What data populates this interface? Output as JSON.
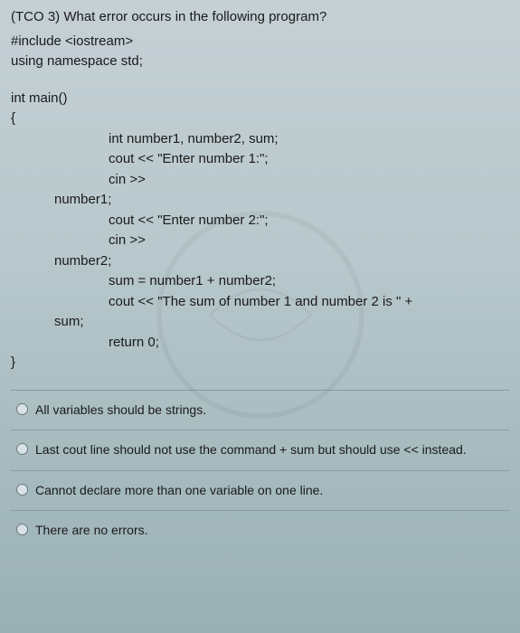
{
  "question": {
    "header": "(TCO 3) What error occurs in the following program?",
    "code_lines": [
      {
        "class": "indent1",
        "text": "#include <iostream>"
      },
      {
        "class": "indent1",
        "text": "using namespace std;"
      },
      {
        "class": "blank",
        "text": ""
      },
      {
        "class": "indent1",
        "text": "int main()"
      },
      {
        "class": "indent1",
        "text": "{"
      },
      {
        "class": "indent3",
        "text": "int number1, number2, sum;"
      },
      {
        "class": "indent3",
        "text": "cout << \"Enter number 1:\";"
      },
      {
        "class": "indent3",
        "text": "cin >>"
      },
      {
        "class": "indent2",
        "text": "number1;"
      },
      {
        "class": "indent3",
        "text": "cout << \"Enter number 2:\";"
      },
      {
        "class": "indent3",
        "text": "cin >>"
      },
      {
        "class": "indent2",
        "text": "number2;"
      },
      {
        "class": "indent3",
        "text": "sum = number1 + number2;"
      },
      {
        "class": "indent3",
        "text": "cout << \"The sum of number 1 and number 2 is \" +"
      },
      {
        "class": "indent2",
        "text": "sum;"
      },
      {
        "class": "indent3",
        "text": "return 0;"
      },
      {
        "class": "indent1",
        "text": "}"
      }
    ]
  },
  "options": [
    {
      "text": "All variables should be strings."
    },
    {
      "text": "Last cout line should not use the command + sum but should use << instead."
    },
    {
      "text": "Cannot declare more than one variable on one line."
    },
    {
      "text": "There are no errors."
    }
  ]
}
